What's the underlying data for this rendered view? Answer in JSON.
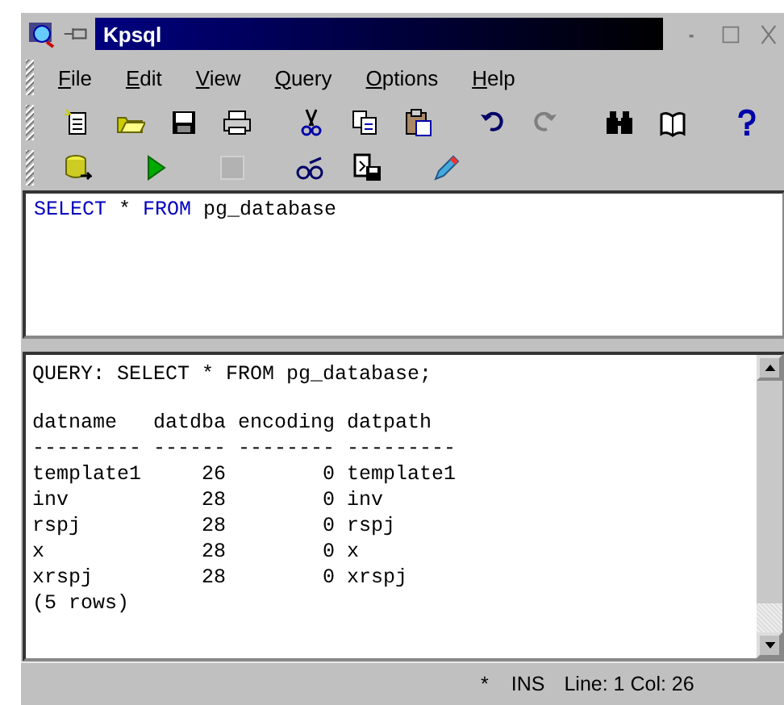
{
  "window": {
    "title": "Kpsql"
  },
  "menu": [
    {
      "label": "File"
    },
    {
      "label": "Edit"
    },
    {
      "label": "View"
    },
    {
      "label": "Query"
    },
    {
      "label": "Options"
    },
    {
      "label": "Help"
    }
  ],
  "toolbars": [
    {
      "buttons": [
        {
          "disabled": false
        },
        {
          "disabled": false
        },
        {
          "disabled": false
        },
        {
          "disabled": false
        },
        {
          "disabled": false
        },
        {
          "disabled": false
        },
        {
          "disabled": false
        },
        {
          "disabled": false
        },
        {
          "disabled": true
        },
        {
          "disabled": false
        },
        {
          "disabled": false
        },
        {
          "disabled": false
        }
      ]
    },
    {
      "buttons": [
        {
          "disabled": false
        },
        {
          "disabled": false
        },
        {
          "disabled": true
        },
        {
          "disabled": false
        },
        {
          "disabled": false
        },
        {
          "disabled": false
        }
      ]
    }
  ],
  "editor": {
    "tokens": [
      {
        "text": "SELECT",
        "keyword": true
      },
      {
        "text": "*",
        "keyword": false
      },
      {
        "text": "FROM",
        "keyword": true
      },
      {
        "text": "pg_database",
        "keyword": false
      }
    ]
  },
  "output": {
    "query_line": "QUERY: SELECT * FROM pg_database;",
    "table_lines": [
      "datname   datdba encoding datpath",
      "--------- ------ -------- ---------",
      "template1     26        0 template1",
      "inv           28        0 inv",
      "rspj          28        0 rspj",
      "x             28        0 x",
      "xrspj         28        0 xrspj",
      "(5 rows)"
    ]
  },
  "status_bar": {
    "modified": "*",
    "mode": "INS",
    "position": "Line: 1 Col: 26"
  }
}
